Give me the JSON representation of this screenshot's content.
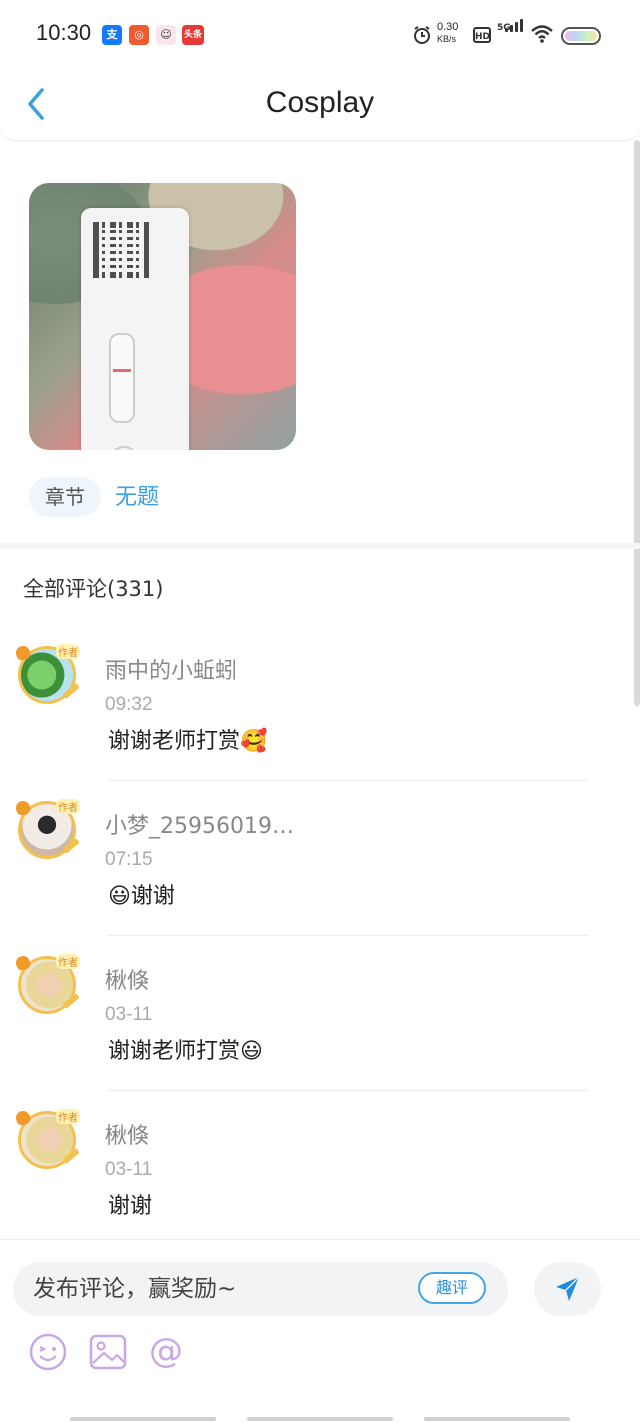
{
  "status_bar": {
    "time": "10:30",
    "apps": [
      {
        "icon": "alipay-icon",
        "label": "支",
        "color": "#1677ff"
      },
      {
        "icon": "app-icon",
        "label": "◎",
        "color": "#ef5a2f"
      },
      {
        "icon": "avatar-app-icon",
        "label": "☺",
        "color": "#fce4ec"
      },
      {
        "icon": "toutiao-icon",
        "label": "头条",
        "color": "#e53935"
      }
    ],
    "net_speed_value": "0.30",
    "net_speed_unit": "KB/s",
    "hd_label": "HD",
    "network": "5G"
  },
  "header": {
    "title": "Cosplay",
    "back_icon": "chevron-left-icon",
    "accent": "#3aa0e0"
  },
  "post": {
    "image_alt": "test strip photo",
    "chapter_tag": "章节",
    "chapter_title": "无题"
  },
  "comments_section": {
    "title": "全部评论(331)",
    "items": [
      {
        "name": "雨中的小蚯蚓",
        "time": "09:32",
        "text": "谢谢老师打赏🥰",
        "badge": "作者"
      },
      {
        "name": "小梦_25956019…",
        "time": "07:15",
        "text": "😃谢谢",
        "badge": "作者"
      },
      {
        "name": "楸倏",
        "time": "03-11",
        "text": "谢谢老师打赏😃",
        "badge": "作者"
      },
      {
        "name": "楸倏",
        "time": "03-11",
        "text": "谢谢",
        "badge": "作者"
      }
    ]
  },
  "composer": {
    "placeholder": "发布评论，赢奖励~",
    "fun_label": "趣评",
    "send_icon": "send-icon",
    "tools": [
      "emoji-icon",
      "image-icon",
      "mention-icon"
    ]
  }
}
